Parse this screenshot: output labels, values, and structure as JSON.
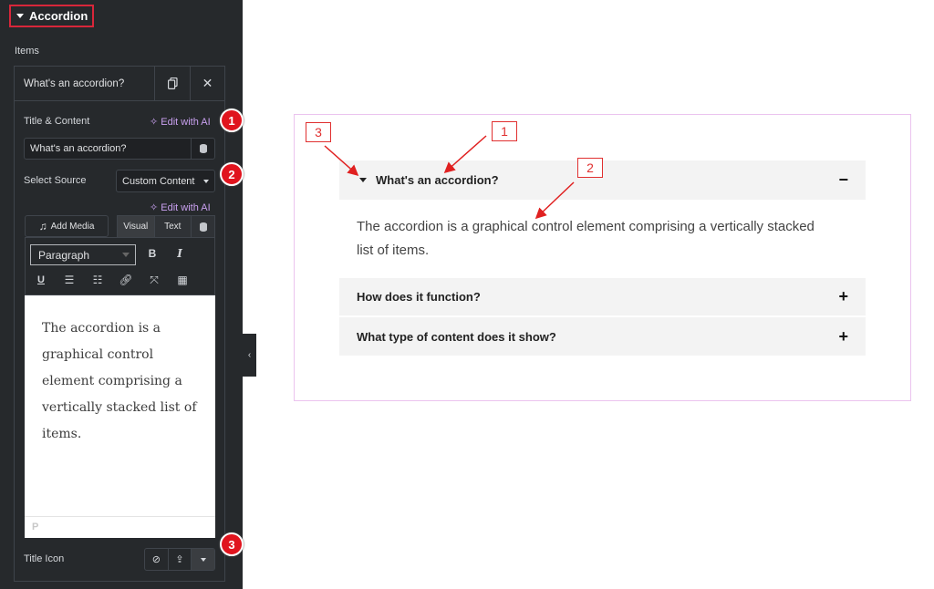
{
  "sidebar": {
    "section_title": "Accordion",
    "items_label": "Items",
    "repeater_item_title": "What's an accordion?",
    "duplicate_icon": "copy-icon",
    "remove_icon": "close-icon",
    "title_content_label": "Title & Content",
    "edit_with_ai_label": "Edit with AI",
    "title_input_value": "What's an accordion?",
    "select_source_label": "Select Source",
    "select_source_value": "Custom Content",
    "add_media_label": "Add Media",
    "editor_tabs": [
      "Visual",
      "Text"
    ],
    "format_select_value": "Paragraph",
    "toolbar_buttons": [
      "bold",
      "italic",
      "underline",
      "bullet-list",
      "numbered-list",
      "link",
      "fullscreen",
      "toolbar-toggle"
    ],
    "editor_content": "The accordion is a graphical control element comprising a vertically stacked list of items.",
    "editor_path": "P",
    "title_icon_label": "Title Icon",
    "collapse_icon": "chevron-left-icon"
  },
  "badges": [
    "1",
    "2",
    "3"
  ],
  "preview": {
    "items": [
      {
        "title": "What's an accordion?",
        "expanded": true,
        "icon": "−"
      },
      {
        "title": "How does it function?",
        "expanded": false,
        "icon": "+"
      },
      {
        "title": "What type of content does it show?",
        "expanded": false,
        "icon": "+"
      }
    ],
    "content": "The accordion is a graphical control element comprising a vertically stacked list of items.",
    "annotations": [
      "1",
      "2",
      "3"
    ]
  },
  "colors": {
    "panel_bg": "#26292c",
    "badge_red": "#e0141e",
    "ai_purple": "#c9a0f0",
    "frame_pink": "#ebc3ef",
    "accordion_bg": "#f3f3f3"
  }
}
